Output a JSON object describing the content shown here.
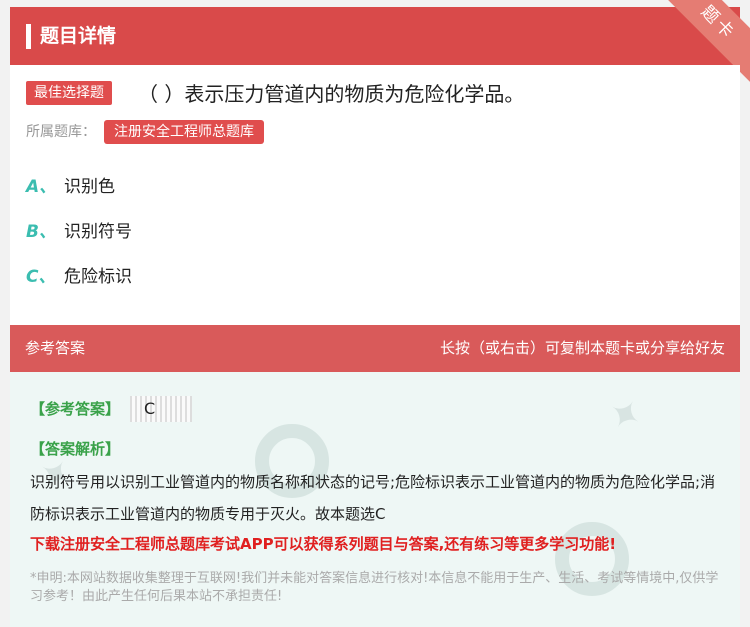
{
  "header": {
    "title": "题目详情",
    "corner_badge": "题卡"
  },
  "question": {
    "type_tag": "最佳选择题",
    "text": "（ ）表示压力管道内的物质为危险化学品。",
    "bank_label": "所属题库：",
    "bank_name": "注册安全工程师总题库"
  },
  "options": [
    {
      "letter": "A、",
      "text": "识别色"
    },
    {
      "letter": "B、",
      "text": "识别符号"
    },
    {
      "letter": "C、",
      "text": "危险标识"
    }
  ],
  "answer_header": {
    "left": "参考答案",
    "right": "长按（或右击）可复制本题卡或分享给好友"
  },
  "answer": {
    "ref_label": "【参考答案】",
    "ref_value": "C",
    "analysis_label": "【答案解析】",
    "analysis_text": "识别符号用以识别工业管道内的物质名称和状态的记号;危险标识表示工业管道内的物质为危险化学品;消防标识表示工业管道内的物质专用于灭火。故本题选C",
    "promo": "下载注册安全工程师总题库考试APP可以获得系列题目与答案,还有练习等更多学习功能!",
    "disclaimer": "*申明:本网站数据收集整理于互联网!我们并未能对答案信息进行核对!本信息不能用于生产、生活、考试等情境中,仅供学习参考！由此产生任何后果本站不承担责任!"
  },
  "colors": {
    "brand_red": "#d94a4a",
    "option_letter": "#3bbdb0",
    "promo_red": "#e02020",
    "tag_green": "#3aa24a"
  }
}
